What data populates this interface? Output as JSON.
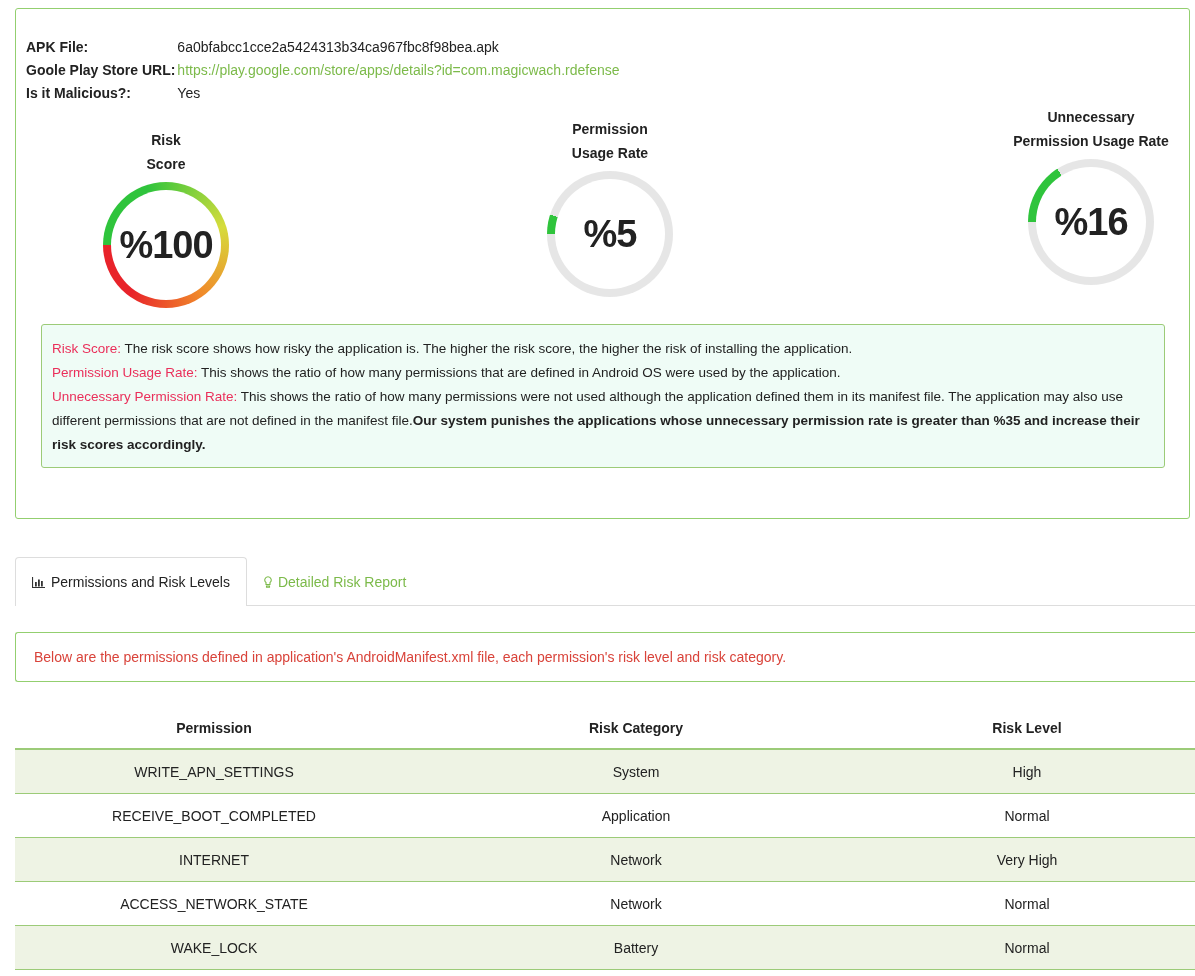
{
  "details": [
    {
      "label": "APK File:",
      "value": "6a0bfabcc1cce2a5424313b34ca967fbc8f98bea.apk",
      "kind": "text"
    },
    {
      "label": "Goole Play Store URL:",
      "value": "https://play.google.com/store/apps/details?id=com.magicwach.rdefense",
      "kind": "link"
    },
    {
      "label": "Is it Malicious?:",
      "value": "Yes",
      "kind": "text"
    }
  ],
  "gauges": [
    {
      "title_lines": [
        "Risk",
        "Score"
      ],
      "reading": "%100"
    },
    {
      "title_lines": [
        "Permission",
        "Usage Rate"
      ],
      "reading": "%5"
    },
    {
      "title_lines": [
        "Unnecessary",
        "Permission Usage Rate"
      ],
      "reading": "%16"
    }
  ],
  "explanations": [
    {
      "label": "Risk Score:",
      "text": "The risk score shows how risky the application is. The higher the risk score, the higher the risk of installing the application."
    },
    {
      "label": "Permission Usage Rate:",
      "text": "This shows the ratio of how many permissions that are defined in Android OS were used by the application."
    },
    {
      "label": "Unnecessary Permission Rate:",
      "text": "This shows the ratio of how many permissions were not used although the application defined them in its manifest file. The application may also use different permissions that are not defined in the manifest file.**Our system punishes the applications whose unnecessary permission rate is greater than %35 and increase their risk scores accordingly.**"
    }
  ],
  "tabs": [
    {
      "label": "Permissions and Risk Levels",
      "selected": true
    },
    {
      "label": "Detailed Risk Report",
      "selected": false
    }
  ],
  "alert": "Below are the permissions defined in application's AndroidManifest.xml file, each permission's risk level and risk category.",
  "table": {
    "columns": [
      "Permission",
      "Risk Category",
      "Risk Level"
    ],
    "rows": [
      [
        "WRITE_APN_SETTINGS",
        "System",
        "High"
      ],
      [
        "RECEIVE_BOOT_COMPLETED",
        "Application",
        "Normal"
      ],
      [
        "INTERNET",
        "Network",
        "Very High"
      ],
      [
        "ACCESS_NETWORK_STATE",
        "Network",
        "Normal"
      ],
      [
        "WAKE_LOCK",
        "Battery",
        "Normal"
      ]
    ]
  }
}
